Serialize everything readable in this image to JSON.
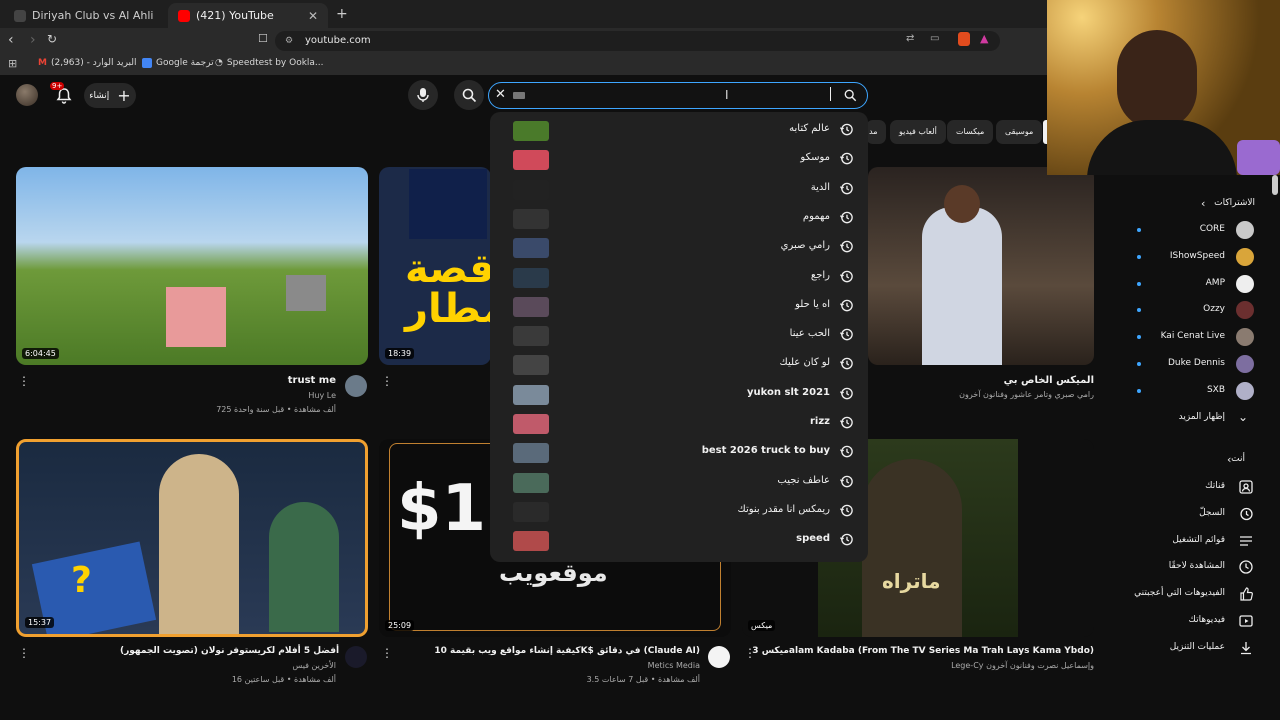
{
  "browser": {
    "tabs": [
      {
        "title": "Diriyah Club vs Al Ahli"
      },
      {
        "title": "(421) YouTube"
      }
    ],
    "url": "youtube.com",
    "bookmarks": [
      {
        "label": "البريد الوارد - (2,963)"
      },
      {
        "label": "Google ترجمة"
      },
      {
        "label": "Speedtest by Ookla..."
      }
    ]
  },
  "header": {
    "notif_count": "9+",
    "create_label": "إنشاء",
    "search_value": ""
  },
  "chips": [
    "موسيقى",
    "ميكسات",
    "ألعاب فيديو",
    "مد"
  ],
  "suggestions": [
    {
      "text": "عالم كتابه",
      "bold": false
    },
    {
      "text": "موسكو",
      "bold": false
    },
    {
      "text": "الدية",
      "bold": false
    },
    {
      "text": "مهموم",
      "bold": false
    },
    {
      "text": "رامي صبري",
      "bold": false
    },
    {
      "text": "راجع",
      "bold": false
    },
    {
      "text": "اه يا حلو",
      "bold": false
    },
    {
      "text": "الحب عينا",
      "bold": false
    },
    {
      "text": "لو كان عليك",
      "bold": false
    },
    {
      "text": "yukon slt 2021",
      "bold": true
    },
    {
      "text": "rizz",
      "bold": true
    },
    {
      "text": "best 2026 truck to buy",
      "bold": true
    },
    {
      "text": "عاطف نجيب",
      "bold": false
    },
    {
      "text": "ريمكس انا مقدر بنوتك",
      "bold": false
    },
    {
      "text": "speed",
      "bold": true
    }
  ],
  "videos": [
    {
      "title": "trust me",
      "channel": "Huy Le",
      "meta": "725 ألف مشاهدة • قبل سنة واحدة",
      "duration": "6:04:45"
    },
    {
      "title": "",
      "channel": "",
      "meta": "",
      "duration": "18:39",
      "overlay": "قصة المطار"
    },
    {
      "title": "الميكس الخاص بي",
      "channel": "رامي صبري وتامر عاشور وفنانون آخرون",
      "meta": "",
      "duration": ""
    },
    {
      "title": "أفضل 5 أفلام لكريستوفر نولان (تصويت الجمهور)",
      "channel": "الأخرين فيس",
      "meta": "16 ألف مشاهدة • قبل ساعتين",
      "duration": "15:37"
    },
    {
      "title": "كيفية إنشاء مواقع ويب بقيمة 10K$ في دقائق (Claude AI)",
      "channel": "Metics Media",
      "meta": "3.5 ألف مشاهدة • قبل 7 ساعات",
      "duration": "25:09",
      "overlay": "موقعويب"
    },
    {
      "title": "ميكس 3alam Kadaba (From The TV Series Ma Trah Lays Kama Ybdo)",
      "channel": "Lege-Cy وإسماعيل نصرت وفنانون آخرون",
      "meta": "",
      "duration": "ميكس"
    }
  ],
  "sidebar": {
    "subs_title": "الاشتراكات",
    "channels": [
      {
        "name": "CORE",
        "color": "#c9c9c9"
      },
      {
        "name": "IShowSpeed",
        "color": "#d9a53a"
      },
      {
        "name": "AMP",
        "color": "#eeeeee"
      },
      {
        "name": "Ozzy",
        "color": "#6b2f2f"
      },
      {
        "name": "Kai Cenat Live",
        "color": "#8a7b70"
      },
      {
        "name": "Duke Dennis",
        "color": "#7d6ea0"
      },
      {
        "name": "SXB",
        "color": "#b0b0c8"
      }
    ],
    "show_more": "إظهار المزيد",
    "you_title": "أنت",
    "you_items": [
      {
        "label": "قناتك",
        "icon": "user-icon"
      },
      {
        "label": "السجلّ",
        "icon": "history-icon"
      },
      {
        "label": "قوائم التشغيل",
        "icon": "playlist-icon"
      },
      {
        "label": "المشاهدة لاحقًا",
        "icon": "clock-icon"
      },
      {
        "label": "الفيديوهات التي أعجبتني",
        "icon": "like-icon"
      },
      {
        "label": "فيديوهاتك",
        "icon": "video-icon"
      },
      {
        "label": "عمليات التنزيل",
        "icon": "download-icon"
      }
    ]
  },
  "colors": {
    "accent": "#3ea6ff",
    "yt_red": "#ff0000",
    "bg": "#0f0f0f"
  }
}
